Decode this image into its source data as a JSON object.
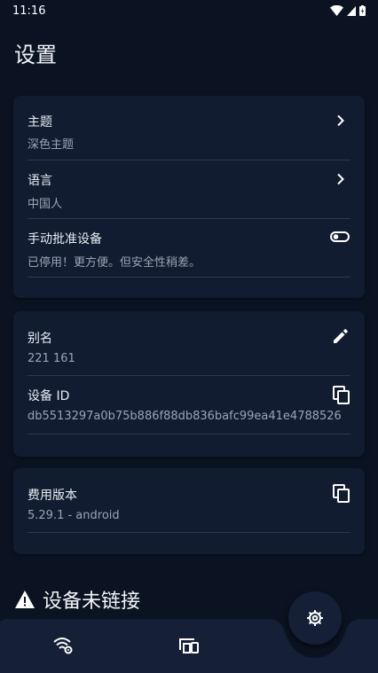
{
  "status_bar": {
    "time": "11:16"
  },
  "page": {
    "title": "设置"
  },
  "card1": {
    "rows": [
      {
        "title": "主题",
        "subtitle": "深色主题",
        "icon": "chevron-right-icon"
      },
      {
        "title": "语言",
        "subtitle": "中国人",
        "icon": "chevron-right-icon"
      },
      {
        "title": "手动批准设备",
        "subtitle": "已停用！更方便。但安全性稍差。",
        "icon": "toggle-off-icon"
      }
    ]
  },
  "card2": {
    "rows": [
      {
        "title": "别名",
        "subtitle": "221 161",
        "icon": "edit-icon"
      },
      {
        "title": "设备 ID",
        "subtitle": "db5513297a0b75b886f88db836bafc99ea41e4788526",
        "icon": "copy-icon"
      }
    ]
  },
  "card3": {
    "rows": [
      {
        "title": "费用版本",
        "subtitle": "5.29.1 - android",
        "icon": "copy-icon"
      }
    ]
  },
  "warning": {
    "text": "设备未链接",
    "icon": "warning-icon"
  },
  "bottom_nav": {
    "items": [
      {
        "icon": "wifi-settings-icon"
      },
      {
        "icon": "devices-icon"
      }
    ],
    "fab_icon": "gear-icon"
  },
  "colors": {
    "background": "#0b1323",
    "card": "#121c30",
    "divider": "#2a3a4c",
    "text_secondary": "#9aa4b4"
  }
}
